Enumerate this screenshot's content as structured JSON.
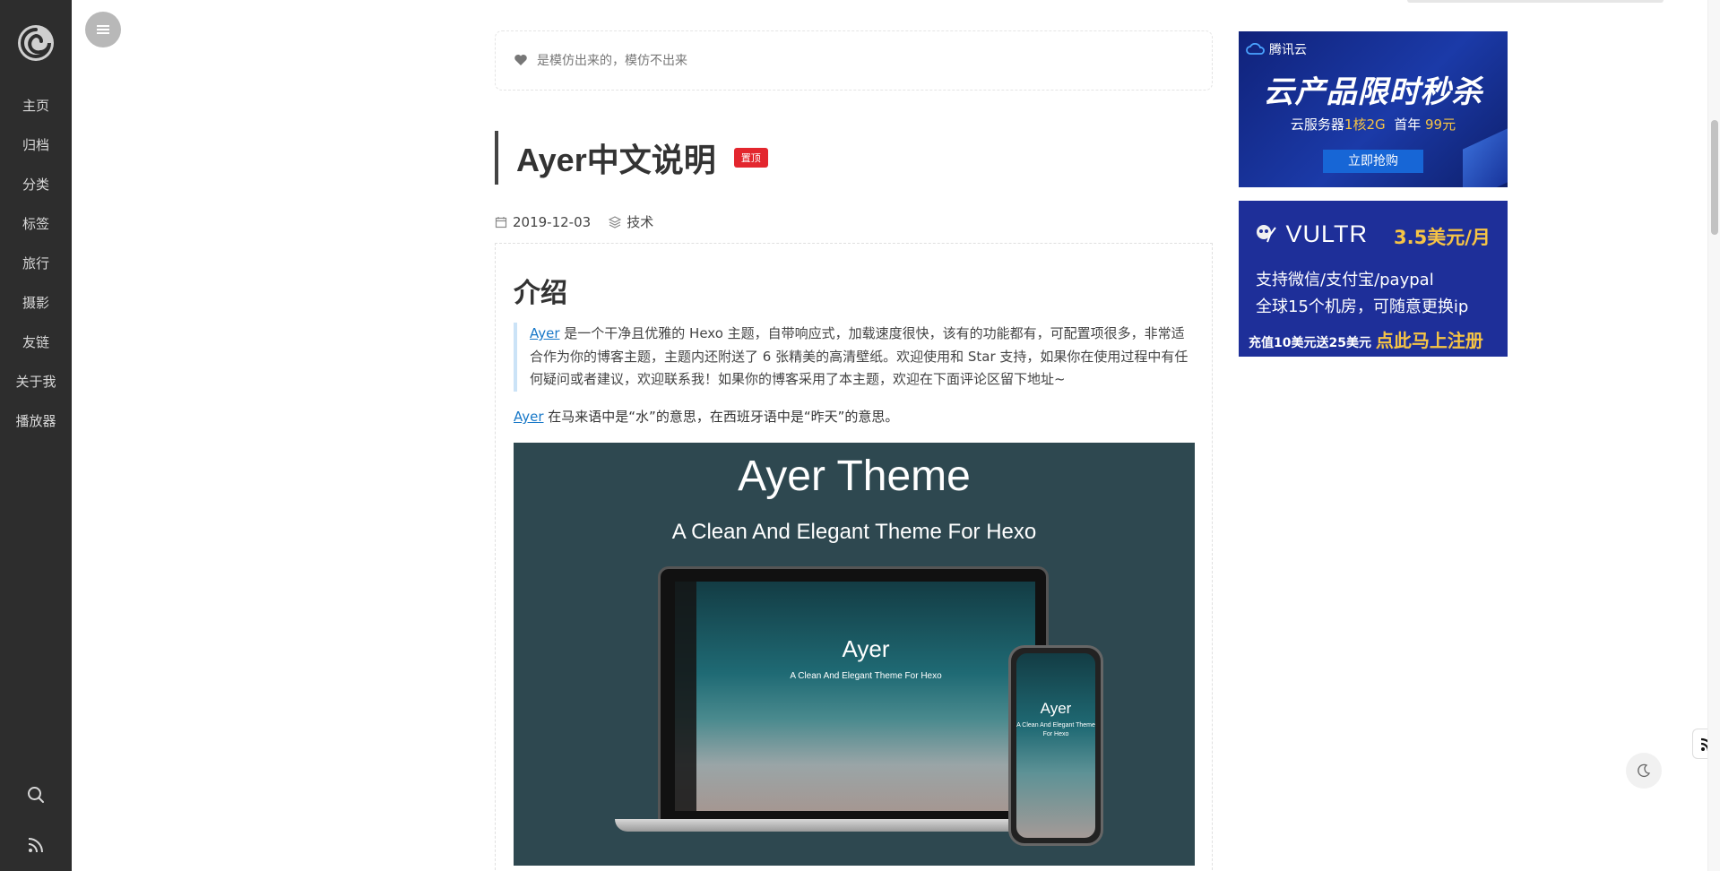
{
  "sidebar": {
    "items": [
      {
        "label": "主页"
      },
      {
        "label": "归档"
      },
      {
        "label": "分类"
      },
      {
        "label": "标签"
      },
      {
        "label": "旅行"
      },
      {
        "label": "摄影"
      },
      {
        "label": "友链"
      },
      {
        "label": "关于我"
      },
      {
        "label": "播放器"
      }
    ],
    "bottom_icons": [
      "search-icon",
      "rss-icon"
    ]
  },
  "motto": {
    "text": "是模仿出来的，模仿不出来",
    "icon": "heart-icon"
  },
  "post": {
    "title": "Ayer中文说明",
    "badge": "置顶",
    "date": "2019-12-03",
    "category": "技术",
    "section_heading": "介绍",
    "quote": {
      "link": "Ayer",
      "text": " 是一个干净且优雅的 Hexo 主题，自带响应式，加载速度很快，该有的功能都有，可配置项很多，非常适合作为你的博客主题，主题内还附送了 6 张精美的高清壁纸。欢迎使用和 Star 支持，如果你在使用过程中有任何疑问或者建议，欢迎联系我！如果你的博客采用了本主题，欢迎在下面评论区留下地址~"
    },
    "para": {
      "link": "Ayer",
      "text": " 在马来语中是“水”的意思，在西班牙语中是“昨天”的意思。"
    },
    "image": {
      "title": "Ayer Theme",
      "subtitle": "A Clean And Elegant Theme For Hexo",
      "laptop_title": "Ayer",
      "laptop_subtitle": "A Clean And Elegant Theme For Hexo",
      "phone_title": "Ayer",
      "phone_subtitle": "A Clean And Elegant Theme For Hexo"
    }
  },
  "ads": {
    "tencent": {
      "brand": "腾讯云",
      "headline": "云产品限时秒杀",
      "sub_a": "云服务器",
      "sub_b": "1核2G",
      "sub_c": "首年",
      "sub_d": "99元",
      "button": "立即抢购"
    },
    "vultr": {
      "brand": "VULTR",
      "price": "3.5美元/月",
      "line1": "支持微信/支付宝/paypal",
      "line2": "全球15个机房，可随意更换ip",
      "line3a": "充值10美元送25美元",
      "line3b": "点此马上注册"
    }
  },
  "colors": {
    "sidebar": "#2d2d2d",
    "accent_link": "#1878c8",
    "badge": "#e3262e",
    "ad_blue": "#1e2f99",
    "ad_yellow": "#f6c445"
  }
}
